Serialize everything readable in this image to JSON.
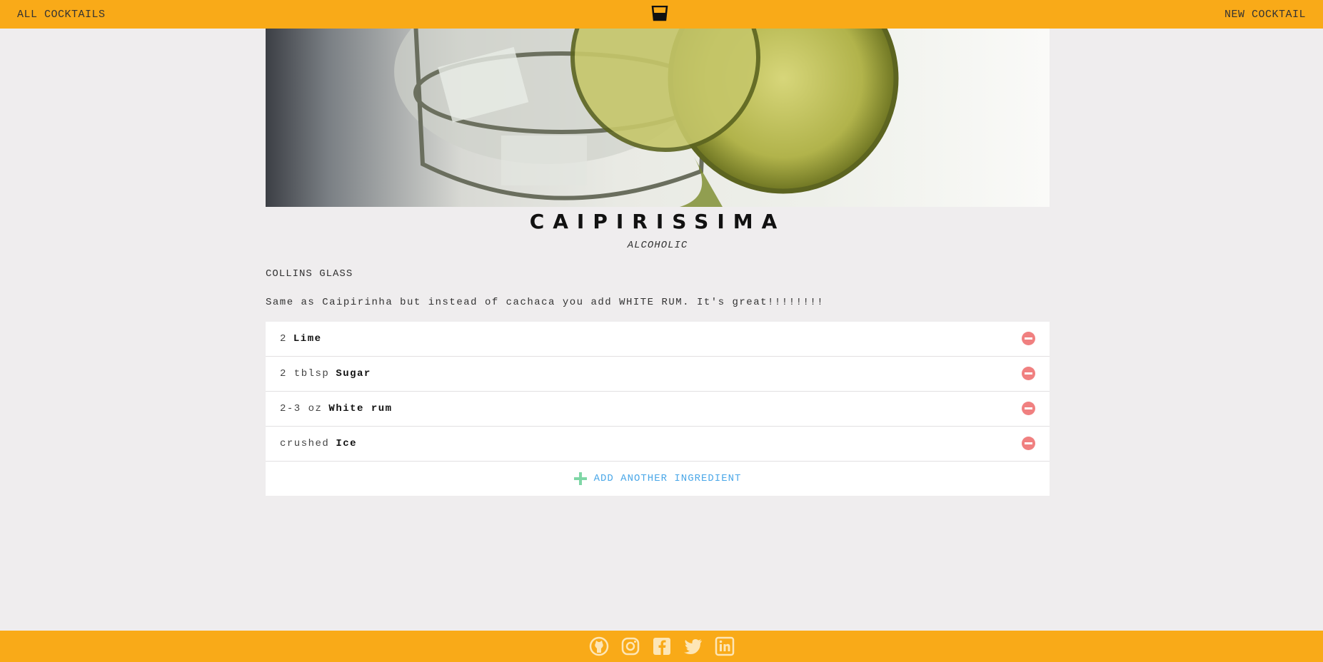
{
  "header": {
    "left_link": "ALL COCKTAILS",
    "right_link": "NEW COCKTAIL",
    "logo_icon": "cocktail-glass-icon",
    "bg_color": "#f9aa18"
  },
  "cocktail": {
    "name": "CAIPIRISSIMA",
    "category": "ALCOHOLIC",
    "glass": "COLLINS GLASS",
    "description": "Same as Caipirinha but instead of cachaca you add WHITE RUM. It's great!!!!!!!!",
    "image_icon": "cocktail-photo"
  },
  "ingredients": [
    {
      "measure": "2",
      "name": "Lime"
    },
    {
      "measure": "2 tblsp",
      "name": "Sugar"
    },
    {
      "measure": "2-3 oz",
      "name": "White rum"
    },
    {
      "measure": "crushed",
      "name": "Ice"
    }
  ],
  "add_ingredient_label": "ADD ANOTHER INGREDIENT",
  "colors": {
    "remove": "#f08080",
    "add_plus": "#7fd6a6",
    "add_text": "#4aa7e8"
  },
  "footer": {
    "icons": [
      "github-icon",
      "instagram-icon",
      "facebook-icon",
      "twitter-icon",
      "linkedin-icon"
    ]
  }
}
